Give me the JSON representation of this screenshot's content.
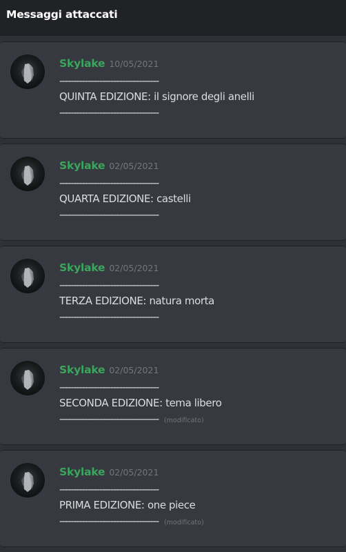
{
  "header": {
    "title": "Messaggi attaccati"
  },
  "messages": [
    {
      "author": "Skylake",
      "timestamp": "10/05/2021",
      "line1": "-----------------------------------",
      "line2": "QUINTA EDIZIONE: il signore degli anelli",
      "line3": "-----------------------------------",
      "edited": ""
    },
    {
      "author": "Skylake",
      "timestamp": "02/05/2021",
      "line1": "-----------------------------------",
      "line2": "QUARTA EDIZIONE: castelli",
      "line3": "-----------------------------------",
      "edited": ""
    },
    {
      "author": "Skylake",
      "timestamp": "02/05/2021",
      "line1": "-----------------------------------",
      "line2": "TERZA EDIZIONE: natura morta",
      "line3": "-----------------------------------",
      "edited": ""
    },
    {
      "author": "Skylake",
      "timestamp": "02/05/2021",
      "line1": "-----------------------------------",
      "line2": "SECONDA EDIZIONE: tema libero",
      "line3": "-----------------------------------",
      "edited": "(modificato)"
    },
    {
      "author": "Skylake",
      "timestamp": "02/05/2021",
      "line1": "-----------------------------------",
      "line2": "PRIMA EDIZIONE: one piece",
      "line3": "-----------------------------------",
      "edited": "(modificato)"
    }
  ],
  "colors": {
    "header_bg": "#202225",
    "panel_bg": "#2f3136",
    "message_bg": "#36393f",
    "author": "#3ba55c",
    "timestamp": "#72767d",
    "text": "#dcddde"
  },
  "icons": {
    "avatar": "avatar-image"
  }
}
